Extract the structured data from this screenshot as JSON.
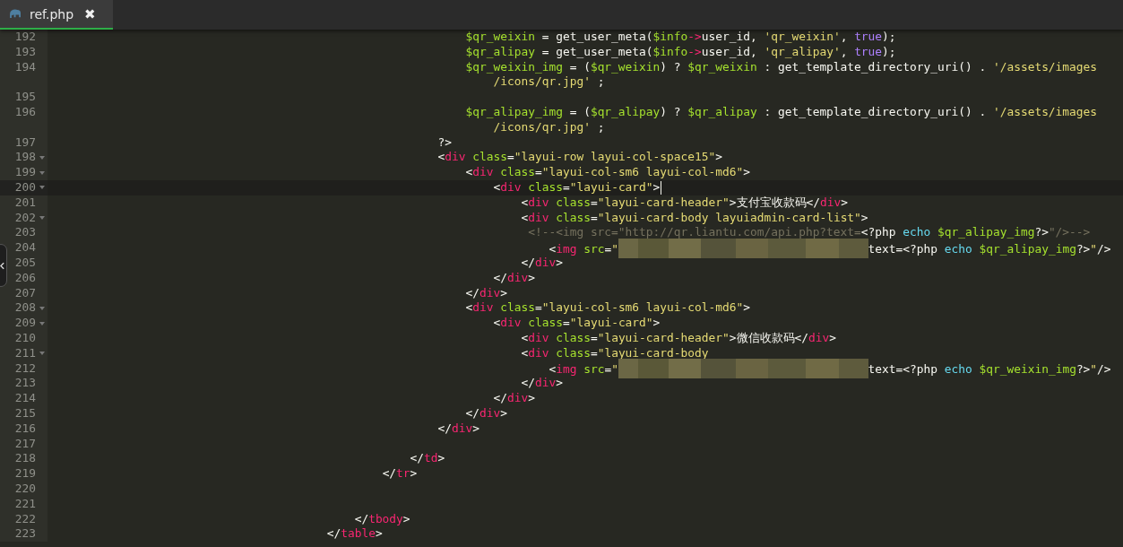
{
  "tabs": [
    {
      "label": "ref.php",
      "close": "✖",
      "selected": true
    }
  ],
  "editor": {
    "lines": [
      {
        "number": "192",
        "fold": false,
        "current": false,
        "code": [
          {
            "kind": "var",
            "text": "                                                            $qr_weixin"
          },
          {
            "kind": "plain",
            "text": " = get_user_meta("
          },
          {
            "kind": "var",
            "text": "$info"
          },
          {
            "kind": "op",
            "text": "->"
          },
          {
            "kind": "plain",
            "text": "user_id, "
          },
          {
            "kind": "string",
            "text": "'qr_weixin'"
          },
          {
            "kind": "plain",
            "text": ", "
          },
          {
            "kind": "const",
            "text": "true"
          },
          {
            "kind": "plain",
            "text": ");"
          }
        ]
      },
      {
        "number": "193",
        "fold": false,
        "current": false,
        "code": [
          {
            "kind": "var",
            "text": "                                                            $qr_alipay"
          },
          {
            "kind": "plain",
            "text": " = get_user_meta("
          },
          {
            "kind": "var",
            "text": "$info"
          },
          {
            "kind": "op",
            "text": "->"
          },
          {
            "kind": "plain",
            "text": "user_id, "
          },
          {
            "kind": "string",
            "text": "'qr_alipay'"
          },
          {
            "kind": "plain",
            "text": ", "
          },
          {
            "kind": "const",
            "text": "true"
          },
          {
            "kind": "plain",
            "text": ");"
          }
        ]
      },
      {
        "number": "194",
        "fold": false,
        "current": false,
        "code": [
          {
            "kind": "var",
            "text": "                                                            $qr_weixin_img"
          },
          {
            "kind": "plain",
            "text": " = ("
          },
          {
            "kind": "var",
            "text": "$qr_weixin"
          },
          {
            "kind": "plain",
            "text": ") ? "
          },
          {
            "kind": "var",
            "text": "$qr_weixin"
          },
          {
            "kind": "plain",
            "text": " : get_template_directory_uri() . "
          },
          {
            "kind": "string",
            "text": "'/assets/images"
          }
        ],
        "wrap": [
          {
            "kind": "string",
            "text": "                                                                /icons/qr.jpg'"
          },
          {
            "kind": "plain",
            "text": " ;"
          }
        ]
      },
      {
        "number": "195",
        "fold": false,
        "current": false
      },
      {
        "number": "196",
        "fold": false,
        "current": false,
        "code": [
          {
            "kind": "var",
            "text": "                                                            $qr_alipay_img"
          },
          {
            "kind": "plain",
            "text": " = ("
          },
          {
            "kind": "var",
            "text": "$qr_alipay"
          },
          {
            "kind": "plain",
            "text": ") ? "
          },
          {
            "kind": "var",
            "text": "$qr_alipay"
          },
          {
            "kind": "plain",
            "text": " : get_template_directory_uri() . "
          },
          {
            "kind": "string",
            "text": "'/assets/images"
          }
        ],
        "wrap": [
          {
            "kind": "string",
            "text": "                                                                /icons/qr.jpg'"
          },
          {
            "kind": "plain",
            "text": " ;"
          }
        ]
      },
      {
        "number": "197",
        "fold": false,
        "current": false,
        "code": [
          {
            "kind": "plain",
            "text": "                                                        ?>"
          }
        ]
      },
      {
        "number": "198",
        "fold": true,
        "current": false,
        "code": [
          {
            "kind": "plain",
            "text": "                                                        <"
          },
          {
            "kind": "tag",
            "text": "div"
          },
          {
            "kind": "attr",
            "text": " class"
          },
          {
            "kind": "plain",
            "text": "="
          },
          {
            "kind": "string",
            "text": "\"layui-row layui-col-space15\""
          },
          {
            "kind": "plain",
            "text": ">"
          }
        ]
      },
      {
        "number": "199",
        "fold": true,
        "current": false,
        "code": [
          {
            "kind": "plain",
            "text": "                                                            <"
          },
          {
            "kind": "tag",
            "text": "div"
          },
          {
            "kind": "attr",
            "text": " class"
          },
          {
            "kind": "plain",
            "text": "="
          },
          {
            "kind": "string",
            "text": "\"layui-col-sm6 layui-col-md6\""
          },
          {
            "kind": "plain",
            "text": ">"
          }
        ]
      },
      {
        "number": "200",
        "fold": true,
        "current": true,
        "code": [
          {
            "kind": "plain",
            "text": "                                                                <"
          },
          {
            "kind": "tag",
            "text": "div"
          },
          {
            "kind": "attr",
            "text": " class"
          },
          {
            "kind": "plain",
            "text": "="
          },
          {
            "kind": "string",
            "text": "\"layui-card\""
          },
          {
            "kind": "plain",
            "text": ">"
          }
        ]
      },
      {
        "number": "201",
        "fold": false,
        "current": false,
        "code": [
          {
            "kind": "plain",
            "text": "                                                                    <"
          },
          {
            "kind": "tag",
            "text": "div"
          },
          {
            "kind": "attr",
            "text": " class"
          },
          {
            "kind": "plain",
            "text": "="
          },
          {
            "kind": "string",
            "text": "\"layui-card-header\""
          },
          {
            "kind": "plain",
            "text": ">支付宝收款码</"
          },
          {
            "kind": "tag",
            "text": "div"
          },
          {
            "kind": "plain",
            "text": ">"
          }
        ]
      },
      {
        "number": "202",
        "fold": true,
        "current": false,
        "code": [
          {
            "kind": "plain",
            "text": "                                                                    <"
          },
          {
            "kind": "tag",
            "text": "div"
          },
          {
            "kind": "attr",
            "text": " class"
          },
          {
            "kind": "plain",
            "text": "="
          },
          {
            "kind": "string",
            "text": "\"layui-card-body layuiadmin-card-list\""
          },
          {
            "kind": "plain",
            "text": ">"
          }
        ]
      },
      {
        "number": "203",
        "fold": false,
        "current": false,
        "code": [
          {
            "kind": "comment",
            "text": "                                                                     <!--<img src=\"http://qr.liantu.com/api.php?text="
          },
          {
            "kind": "plain",
            "text": "<?php "
          },
          {
            "kind": "keyword",
            "text": "echo "
          },
          {
            "kind": "var",
            "text": "$qr_alipay_img"
          },
          {
            "kind": "plain",
            "text": "?>"
          },
          {
            "kind": "comment",
            "text": "\"/>-->"
          }
        ]
      },
      {
        "number": "204",
        "fold": false,
        "current": false,
        "code": [
          {
            "kind": "plain",
            "text": "                                                                        <"
          },
          {
            "kind": "tag",
            "text": "img"
          },
          {
            "kind": "attr",
            "text": " src"
          },
          {
            "kind": "plain",
            "text": "="
          },
          {
            "kind": "string",
            "text": "\""
          },
          {
            "kind": "redacted"
          },
          {
            "kind": "plain",
            "text": "text=<?php "
          },
          {
            "kind": "keyword",
            "text": "echo "
          },
          {
            "kind": "var",
            "text": "$qr_alipay_img"
          },
          {
            "kind": "plain",
            "text": "?>"
          },
          {
            "kind": "string",
            "text": "\""
          },
          {
            "kind": "plain",
            "text": "/>"
          }
        ]
      },
      {
        "number": "205",
        "fold": false,
        "current": false,
        "code": [
          {
            "kind": "plain",
            "text": "                                                                    </"
          },
          {
            "kind": "tag",
            "text": "div"
          },
          {
            "kind": "plain",
            "text": ">"
          }
        ]
      },
      {
        "number": "206",
        "fold": false,
        "current": false,
        "code": [
          {
            "kind": "plain",
            "text": "                                                                </"
          },
          {
            "kind": "tag",
            "text": "div"
          },
          {
            "kind": "plain",
            "text": ">"
          }
        ]
      },
      {
        "number": "207",
        "fold": false,
        "current": false,
        "code": [
          {
            "kind": "plain",
            "text": "                                                            </"
          },
          {
            "kind": "tag",
            "text": "div"
          },
          {
            "kind": "plain",
            "text": ">"
          }
        ]
      },
      {
        "number": "208",
        "fold": true,
        "current": false,
        "code": [
          {
            "kind": "plain",
            "text": "                                                            <"
          },
          {
            "kind": "tag",
            "text": "div"
          },
          {
            "kind": "attr",
            "text": " class"
          },
          {
            "kind": "plain",
            "text": "="
          },
          {
            "kind": "string",
            "text": "\"layui-col-sm6 layui-col-md6\""
          },
          {
            "kind": "plain",
            "text": ">"
          }
        ]
      },
      {
        "number": "209",
        "fold": true,
        "current": false,
        "code": [
          {
            "kind": "plain",
            "text": "                                                                <"
          },
          {
            "kind": "tag",
            "text": "div"
          },
          {
            "kind": "attr",
            "text": " class"
          },
          {
            "kind": "plain",
            "text": "="
          },
          {
            "kind": "string",
            "text": "\"layui-card\""
          },
          {
            "kind": "plain",
            "text": ">"
          }
        ]
      },
      {
        "number": "210",
        "fold": false,
        "current": false,
        "code": [
          {
            "kind": "plain",
            "text": "                                                                    <"
          },
          {
            "kind": "tag",
            "text": "div"
          },
          {
            "kind": "attr",
            "text": " class"
          },
          {
            "kind": "plain",
            "text": "="
          },
          {
            "kind": "string",
            "text": "\"layui-card-header\""
          },
          {
            "kind": "plain",
            "text": ">微信收款码</"
          },
          {
            "kind": "tag",
            "text": "div"
          },
          {
            "kind": "plain",
            "text": ">"
          }
        ]
      },
      {
        "number": "211",
        "fold": true,
        "current": false,
        "code": [
          {
            "kind": "plain",
            "text": "                                                                    <"
          },
          {
            "kind": "tag",
            "text": "div"
          },
          {
            "kind": "attr",
            "text": " class"
          },
          {
            "kind": "plain",
            "text": "="
          },
          {
            "kind": "string",
            "text": "\"layui-card-body"
          }
        ]
      },
      {
        "number": "212",
        "fold": false,
        "current": false,
        "code": [
          {
            "kind": "plain",
            "text": "                                                                        <"
          },
          {
            "kind": "tag",
            "text": "img"
          },
          {
            "kind": "attr",
            "text": " src"
          },
          {
            "kind": "plain",
            "text": "="
          },
          {
            "kind": "string",
            "text": "\""
          },
          {
            "kind": "redacted"
          },
          {
            "kind": "plain",
            "text": "text=<?php "
          },
          {
            "kind": "keyword",
            "text": "echo "
          },
          {
            "kind": "var",
            "text": "$qr_weixin_img"
          },
          {
            "kind": "plain",
            "text": "?>"
          },
          {
            "kind": "string",
            "text": "\""
          },
          {
            "kind": "plain",
            "text": "/>"
          }
        ]
      },
      {
        "number": "213",
        "fold": false,
        "current": false,
        "code": [
          {
            "kind": "plain",
            "text": "                                                                    </"
          },
          {
            "kind": "tag",
            "text": "div"
          },
          {
            "kind": "plain",
            "text": ">"
          }
        ]
      },
      {
        "number": "214",
        "fold": false,
        "current": false,
        "code": [
          {
            "kind": "plain",
            "text": "                                                                </"
          },
          {
            "kind": "tag",
            "text": "div"
          },
          {
            "kind": "plain",
            "text": ">"
          }
        ]
      },
      {
        "number": "215",
        "fold": false,
        "current": false,
        "code": [
          {
            "kind": "plain",
            "text": "                                                            </"
          },
          {
            "kind": "tag",
            "text": "div"
          },
          {
            "kind": "plain",
            "text": ">"
          }
        ]
      },
      {
        "number": "216",
        "fold": false,
        "current": false,
        "code": [
          {
            "kind": "plain",
            "text": "                                                        </"
          },
          {
            "kind": "tag",
            "text": "div"
          },
          {
            "kind": "plain",
            "text": ">"
          }
        ]
      },
      {
        "number": "217",
        "fold": false,
        "current": false
      },
      {
        "number": "218",
        "fold": false,
        "current": false,
        "code": [
          {
            "kind": "plain",
            "text": "                                                    </"
          },
          {
            "kind": "tag",
            "text": "td"
          },
          {
            "kind": "plain",
            "text": ">"
          }
        ]
      },
      {
        "number": "219",
        "fold": false,
        "current": false,
        "code": [
          {
            "kind": "plain",
            "text": "                                                </"
          },
          {
            "kind": "tag",
            "text": "tr"
          },
          {
            "kind": "plain",
            "text": ">"
          }
        ]
      },
      {
        "number": "220",
        "fold": false,
        "current": false
      },
      {
        "number": "221",
        "fold": false,
        "current": false
      },
      {
        "number": "222",
        "fold": false,
        "current": false,
        "code": [
          {
            "kind": "plain",
            "text": "                                            </"
          },
          {
            "kind": "tag",
            "text": "tbody"
          },
          {
            "kind": "plain",
            "text": ">"
          }
        ]
      },
      {
        "number": "223",
        "fold": false,
        "current": false,
        "code": [
          {
            "kind": "plain",
            "text": "                                        </"
          },
          {
            "kind": "tag",
            "text": "table"
          },
          {
            "kind": "plain",
            "text": ">"
          }
        ]
      }
    ]
  }
}
